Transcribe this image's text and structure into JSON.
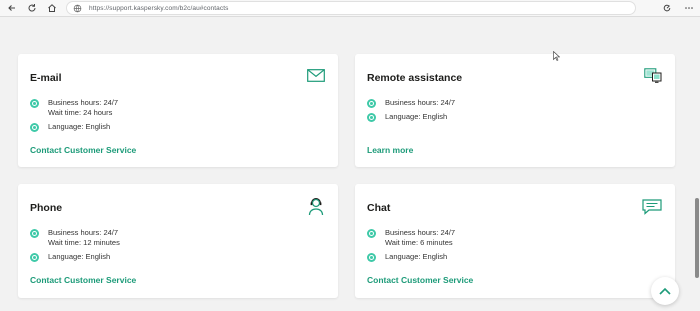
{
  "browser": {
    "url": "https://support.kaspersky.com/b2c/au#contacts"
  },
  "colors": {
    "accent": "#1d9b79",
    "dot": "#3fc9a8"
  },
  "cards": [
    {
      "title": "E-mail",
      "icon": "envelope-icon",
      "rows": [
        [
          "Business hours: 24/7",
          "Wait time: 24 hours"
        ],
        [
          "Language: English"
        ]
      ],
      "link": "Contact Customer Service"
    },
    {
      "title": "Remote assistance",
      "icon": "remote-devices-icon",
      "rows": [
        [
          "Business hours: 24/7"
        ],
        [
          "Language: English"
        ]
      ],
      "link": "Learn more"
    },
    {
      "title": "Phone",
      "icon": "support-agent-icon",
      "rows": [
        [
          "Business hours: 24/7",
          "Wait time: 12 minutes"
        ],
        [
          "Language: English"
        ]
      ],
      "link": "Contact Customer Service"
    },
    {
      "title": "Chat",
      "icon": "chat-bubble-icon",
      "rows": [
        [
          "Business hours: 24/7",
          "Wait time: 6 minutes"
        ],
        [
          "Language: English"
        ]
      ],
      "link": "Contact Customer Service"
    }
  ]
}
